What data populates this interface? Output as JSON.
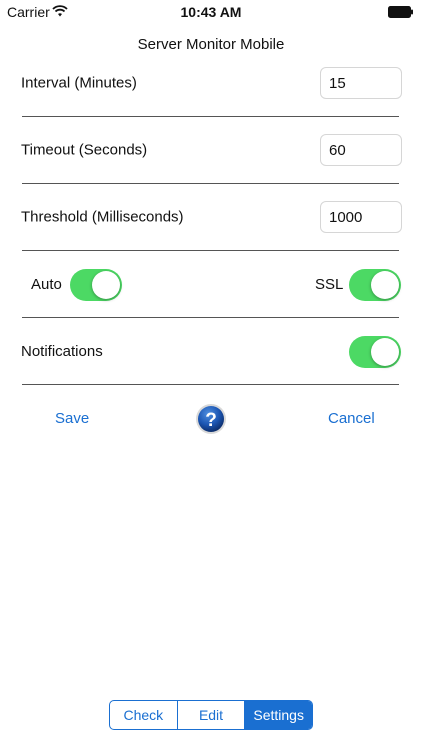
{
  "status_bar": {
    "carrier": "Carrier",
    "time": "10:43 AM"
  },
  "app": {
    "title": "Server Monitor Mobile"
  },
  "settings": {
    "interval": {
      "label": "Interval (Minutes)",
      "value": "15"
    },
    "timeout": {
      "label": "Timeout (Seconds)",
      "value": "60"
    },
    "threshold": {
      "label": "Threshold (Milliseconds)",
      "value": "1000"
    },
    "auto": {
      "label": "Auto",
      "on": true
    },
    "ssl": {
      "label": "SSL",
      "on": true
    },
    "notifications": {
      "label": "Notifications",
      "on": true
    }
  },
  "actions": {
    "save": "Save",
    "cancel": "Cancel",
    "help_icon": "question-mark-icon"
  },
  "tabs": [
    {
      "label": "Check",
      "active": false
    },
    {
      "label": "Edit",
      "active": false
    },
    {
      "label": "Settings",
      "active": true
    }
  ],
  "colors": {
    "accent": "#1a6fd1",
    "toggle_on": "#4cd964"
  }
}
